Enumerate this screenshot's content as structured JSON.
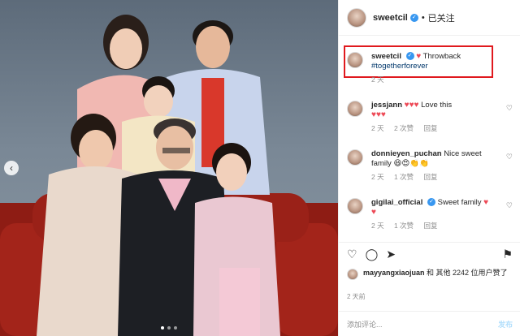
{
  "post": {
    "username": "sweetcil",
    "verified_mark": "✓",
    "separator": "•",
    "follow_label": "已关注",
    "caption_text": "Throwback",
    "caption_tag": "#togetherforever",
    "caption_time": "2 天"
  },
  "comments": [
    {
      "user": "jessjann",
      "hearts_inline": "♥♥♥",
      "text": "Love this",
      "hearts_next": "♥♥♥",
      "time": "2 天",
      "likes": "2 次赞",
      "reply": "回复"
    },
    {
      "user": "donnieyen_puchan",
      "text": "Nice sweet family",
      "emoji": "😆😍👏👏",
      "time": "2 天",
      "likes": "1 次赞",
      "reply": "回复"
    },
    {
      "user": "gigilai_official",
      "text": "Sweet family",
      "hearts_inline": "♥",
      "hearts_next": "♥",
      "time": "2 天",
      "likes": "1 次赞",
      "reply": "回复"
    }
  ],
  "liked_by": {
    "user": "mayyangxiaojuan",
    "rest": " 和 其他 2242 位用户赞了"
  },
  "time_big": "2 天前",
  "add_comment": {
    "placeholder": "添加评论...",
    "post_label": "发布"
  },
  "icons": [
    "chevron-left-icon",
    "heart-outline-icon",
    "comment-icon",
    "share-icon",
    "bookmark-icon"
  ],
  "colors": {
    "highlight_border": "#e0191e",
    "verified": "#3897f0",
    "heart": "#ed4956",
    "link": "#00376b"
  }
}
